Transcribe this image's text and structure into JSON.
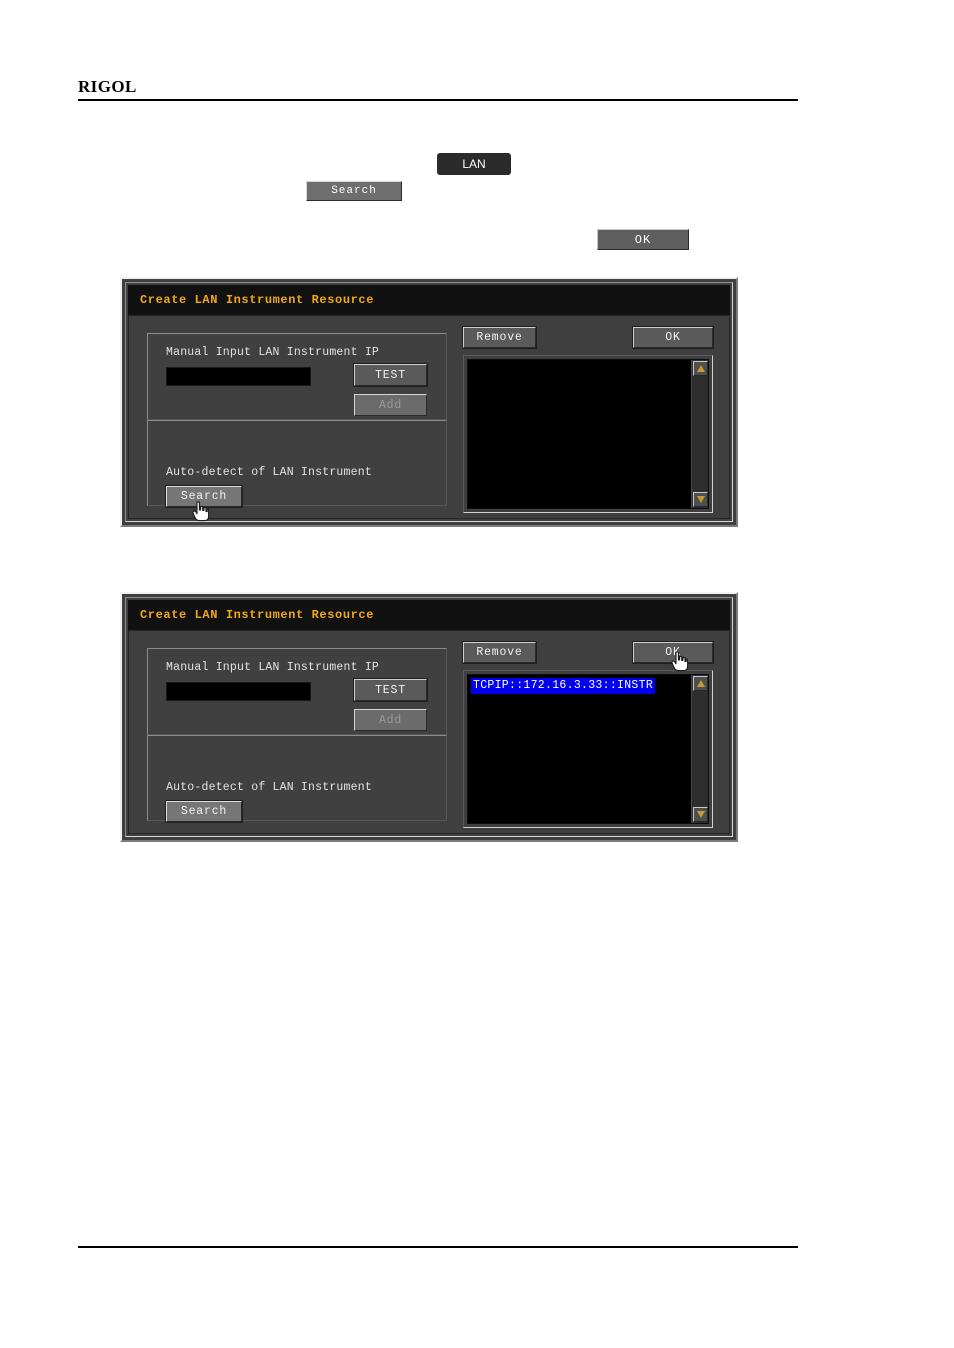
{
  "page": {
    "brand": "RIGOL"
  },
  "inline_chips": [
    {
      "name": "lan-chip",
      "label": "LAN"
    },
    {
      "name": "search-chip",
      "label": "Search"
    },
    {
      "name": "ok-chip",
      "label": "OK"
    }
  ],
  "colors": {
    "title_text": "#f0a818",
    "dialog_bg": "#3f3f3f",
    "listbox_bg": "#000000",
    "selection_bg": "#0000ee",
    "scroll_arrow": "#c79a30",
    "button_face": "#5a5a5a"
  },
  "dialog": {
    "title": "Create LAN Instrument Resource",
    "manual_group": {
      "label": "Manual Input LAN Instrument IP",
      "ip_value": "",
      "ip_placeholder": "",
      "test_label": "TEST",
      "add_label": "Add"
    },
    "auto_group": {
      "label": "Auto-detect of LAN Instrument",
      "search_label": "Search"
    },
    "right_panel": {
      "remove_label": "Remove",
      "ok_label": "OK",
      "scroll_up": "▲",
      "scroll_down": "▼"
    }
  },
  "dialog_one": {
    "resources": [],
    "cursor_on": "search-button"
  },
  "dialog_two": {
    "resources": [
      {
        "label": "TCPIP::172.16.3.33::INSTR",
        "selected": true
      }
    ],
    "cursor_on": "ok-button"
  }
}
